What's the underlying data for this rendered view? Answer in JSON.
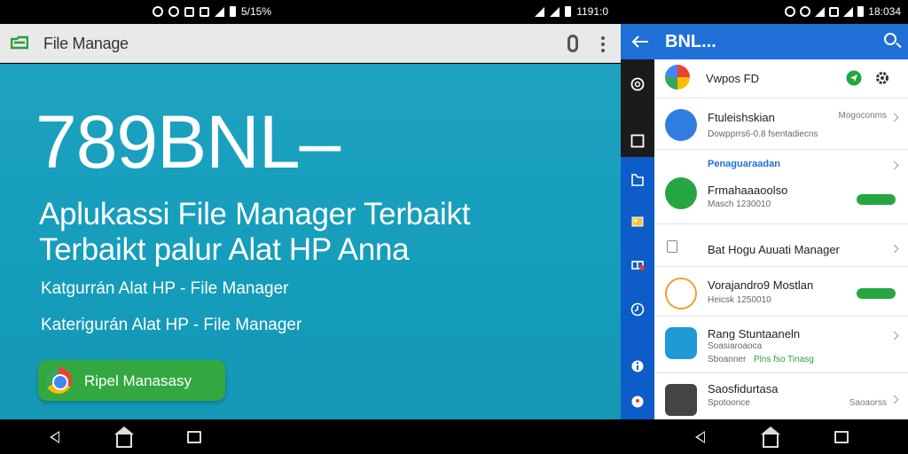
{
  "left": {
    "statusbar": {
      "center_text": "5/15%",
      "right_text": "1191:0"
    },
    "appbar": {
      "title": "File Manage"
    },
    "hero": {
      "title": "789BNL–",
      "subtitle_line1": "Aplukassi File Manager  Terbaikt",
      "subtitle_line2": "Terbaikt palur Alat HP Anna",
      "line1": "Katgurrán Alat HP - File Manager",
      "line2": "Katerigurán Alat HP - File Manager",
      "cta_label": "Ripel Manasasy"
    },
    "colors": {
      "hero_bg": "#1ea2c0",
      "cta_bg": "#34a840",
      "appbar_bg": "#e9e9e9"
    }
  },
  "right": {
    "statusbar": {
      "text": "18:034"
    },
    "appbar": {
      "title": "BNL..."
    },
    "rows": [
      {
        "title": "Vwpos FD",
        "sub": "",
        "meta": ""
      },
      {
        "title": "Ftuleishskian",
        "sub": "Dowpprrs6-0.8 fsentadiecns",
        "meta": "Mogoconms"
      },
      {
        "section": "Penaguaraadan"
      },
      {
        "title": "Frmahaaaoolso",
        "sub": "Masch 1230010",
        "pill": ""
      },
      {
        "title": "Bat Hogu Auuati Manager",
        "sub": ""
      },
      {
        "title": "Vorajandro9 Mostlan",
        "sub": "Heicsk 1250010",
        "pill": ""
      },
      {
        "title": "Rang Stuntaaneln",
        "sub": "Soasiaroaoca",
        "sub2_left": "Sboanner",
        "sub2_right": "Plns fso Tinasg"
      },
      {
        "title": "Saosfidurtasa",
        "sub": "Spotoonce",
        "meta": "Saoaorss"
      }
    ],
    "colors": {
      "appbar_bg": "#1f6fd6",
      "rail_bg": "#0e5cc7",
      "accent_green": "#26a641"
    }
  }
}
